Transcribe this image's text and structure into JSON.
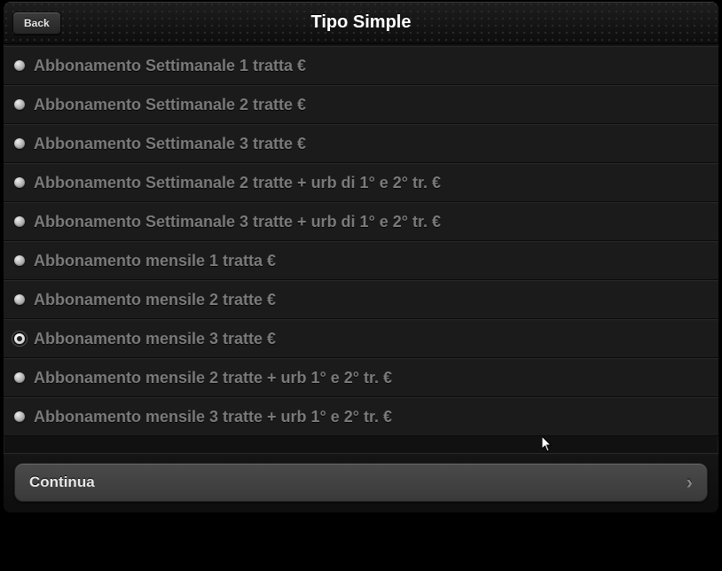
{
  "header": {
    "back_label": "Back",
    "title": "Tipo Simple"
  },
  "options": [
    {
      "label": "Abbonamento Settimanale 1 tratta €",
      "selected": false
    },
    {
      "label": "Abbonamento Settimanale 2 tratte €",
      "selected": false
    },
    {
      "label": "Abbonamento Settimanale 3 tratte €",
      "selected": false
    },
    {
      "label": "Abbonamento Settimanale 2 tratte + urb di 1° e 2° tr. €",
      "selected": false
    },
    {
      "label": "Abbonamento Settimanale 3 tratte + urb di 1° e 2° tr. €",
      "selected": false
    },
    {
      "label": "Abbonamento mensile 1 tratta €",
      "selected": false
    },
    {
      "label": "Abbonamento mensile 2 tratte €",
      "selected": false
    },
    {
      "label": "Abbonamento mensile 3 tratte €",
      "selected": true
    },
    {
      "label": "Abbonamento mensile 2 tratte + urb 1° e 2° tr. €",
      "selected": false
    },
    {
      "label": "Abbonamento mensile 3 tratte + urb 1° e 2° tr. €",
      "selected": false
    }
  ],
  "footer": {
    "continue_label": "Continua"
  }
}
